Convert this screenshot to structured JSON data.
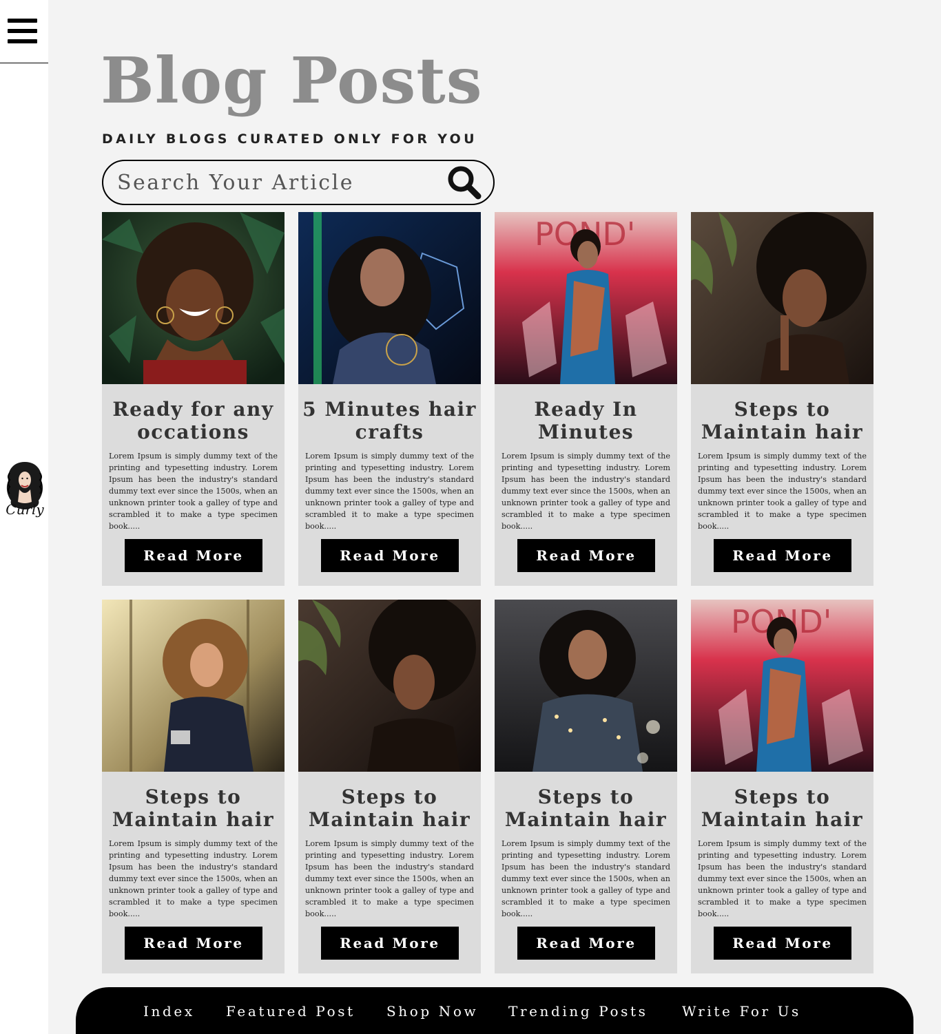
{
  "header": {
    "title": "Blog Posts",
    "subtitle": "DAILY BLOGS CURATED ONLY FOR YOU"
  },
  "search": {
    "placeholder": "Search Your Article",
    "icon": "search-icon"
  },
  "sidebar": {
    "menu_icon": "hamburger-icon",
    "logo_text": "Curly"
  },
  "posts": [
    {
      "title": "Ready for any occations",
      "excerpt": "Lorem Ipsum is simply dummy text of the printing and typesetting industry. Lorem Ipsum has been the industry's standard dummy text ever since the 1500s, when an unknown printer took a galley of type and scrambled it to make a type specimen book.....",
      "button": "Read More"
    },
    {
      "title": "5 Minutes hair crafts",
      "excerpt": "Lorem Ipsum is simply dummy text of the printing and typesetting industry. Lorem Ipsum has been the industry's standard dummy text ever since the 1500s, when an unknown printer took a galley of type and scrambled it to make a type specimen book.....",
      "button": "Read More"
    },
    {
      "title": "Ready In Minutes",
      "excerpt": "Lorem Ipsum is simply dummy text of the printing and typesetting industry. Lorem Ipsum has been the industry's standard dummy text ever since the 1500s, when an unknown printer took a galley of type and scrambled it to make a type specimen book.....",
      "button": "Read More"
    },
    {
      "title": "Steps to Maintain hair",
      "excerpt": "Lorem Ipsum is simply dummy text of the printing and typesetting industry. Lorem Ipsum has been the industry's standard dummy text ever since the 1500s, when an unknown printer took a galley of type and scrambled it to make a type specimen book.....",
      "button": "Read More"
    },
    {
      "title": "Steps to Maintain hair",
      "excerpt": "Lorem Ipsum is simply dummy text of the printing and typesetting industry. Lorem Ipsum has been the industry's standard dummy text ever since the 1500s, when an unknown printer took a galley of type and scrambled it to make a type specimen book.....",
      "button": "Read More"
    },
    {
      "title": "Steps to Maintain hair",
      "excerpt": "Lorem Ipsum is simply dummy text of the printing and typesetting industry. Lorem Ipsum has been the industry's standard dummy text ever since the 1500s, when an unknown printer took a galley of type and scrambled it to make a type specimen book.....",
      "button": "Read More"
    },
    {
      "title": "Steps to Maintain hair",
      "excerpt": "Lorem Ipsum is simply dummy text of the printing and typesetting industry. Lorem Ipsum has been the industry's standard dummy text ever since the 1500s, when an unknown printer took a galley of type and scrambled it to make a type specimen book.....",
      "button": "Read More"
    },
    {
      "title": "Steps to Maintain hair",
      "excerpt": "Lorem Ipsum is simply dummy text of the printing and typesetting industry. Lorem Ipsum has been the industry's standard dummy text ever since the 1500s, when an unknown printer took a galley of type and scrambled it to make a type specimen book.....",
      "button": "Read More"
    }
  ],
  "footer": {
    "nav": [
      "Index",
      "Featured Post",
      "Shop Now",
      "Trending Posts",
      "Write For Us"
    ]
  },
  "colors": {
    "title_gray": "#8c8c8c",
    "card_bg": "#dcdcdc",
    "page_bg": "#f3f3f3",
    "button_bg": "#000000"
  }
}
